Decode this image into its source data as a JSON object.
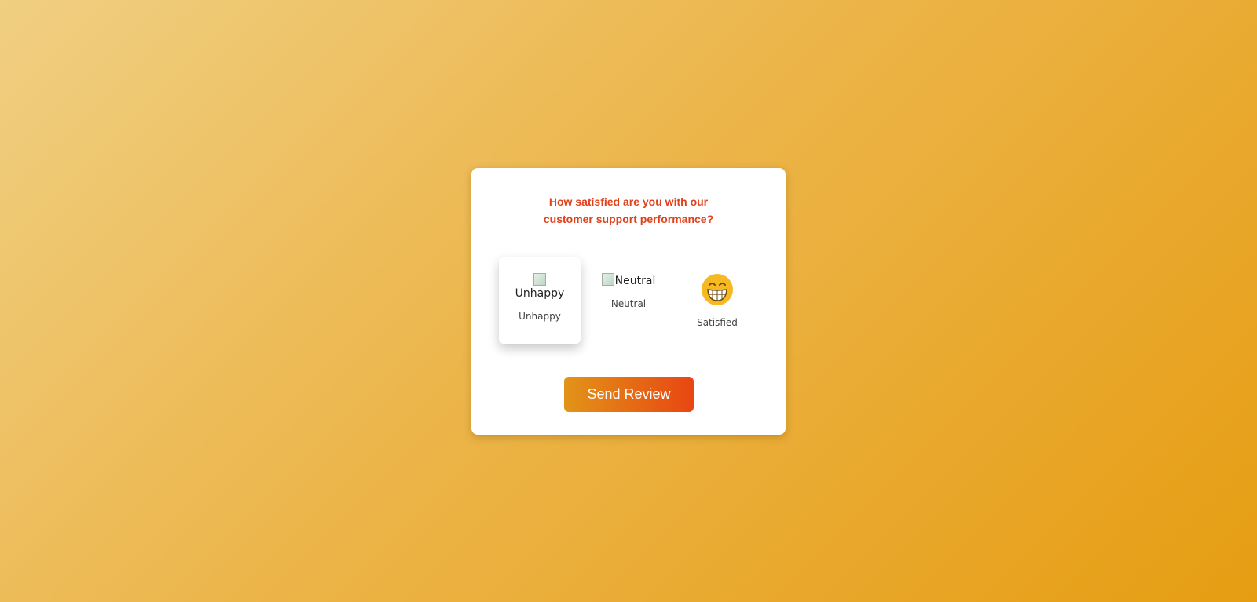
{
  "question": "How satisfied are you with our customer support performance?",
  "ratings": [
    {
      "label": "Unhappy",
      "alt": "Unhappy",
      "image_state": "broken",
      "selected": true
    },
    {
      "label": "Neutral",
      "alt": "Neutral",
      "image_state": "broken",
      "selected": false
    },
    {
      "label": "Satisfied",
      "icon": "grinning-face-icon",
      "selected": false
    }
  ],
  "send_button": "Send Review",
  "colors": {
    "question_text": "#e0411b",
    "button_gradient_start": "#e29418",
    "button_gradient_end": "#e84612",
    "background_start": "#f0cf82",
    "background_end": "#e69d12",
    "emoji_yellow": "#f6b921"
  }
}
